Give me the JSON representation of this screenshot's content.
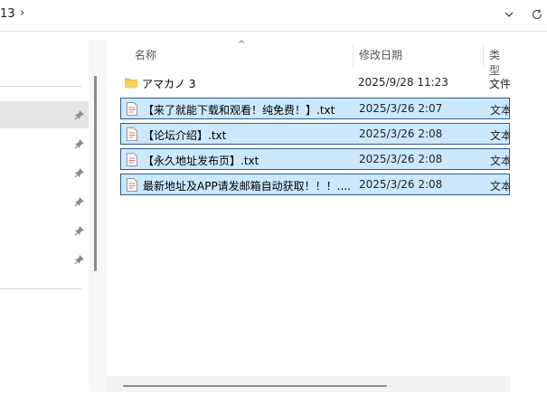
{
  "address": {
    "crumb": "13",
    "separator": "›"
  },
  "columns": {
    "name": "名称",
    "date": "修改日期",
    "type": "类型"
  },
  "rows": [
    {
      "name": "アマカノ 3",
      "date": "2025/9/28 11:23",
      "type": "文件",
      "kind": "folder",
      "selected": false
    },
    {
      "name": "【来了就能下载和观看！纯免费！】.txt",
      "date": "2025/3/26 2:07",
      "type": "文本",
      "kind": "txt",
      "selected": true
    },
    {
      "name": "【论坛介绍】.txt",
      "date": "2025/3/26 2:08",
      "type": "文本",
      "kind": "txt",
      "selected": true
    },
    {
      "name": "【永久地址发布页】.txt",
      "date": "2025/3/26 2:08",
      "type": "文本",
      "kind": "txt",
      "selected": true
    },
    {
      "name": "最新地址及APP请发邮箱自动获取！！！....",
      "date": "2025/3/26 2:08",
      "type": "文本",
      "kind": "txt",
      "selected": true
    }
  ],
  "colors": {
    "selection_fill": "#cce8ff",
    "selection_border": "#2d5d8a",
    "folder": "#f5c542",
    "nav_selected": "#e5e5e5"
  }
}
